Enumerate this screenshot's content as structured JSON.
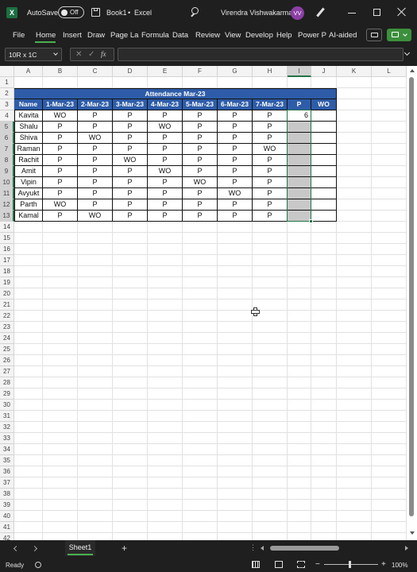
{
  "titlebar": {
    "autosave_label": "AutoSave",
    "toggle_label": "Off",
    "file_name": "Book1",
    "separator": "•",
    "app_name": "Excel",
    "user_name": "Virendra Vishwakarma",
    "avatar_initials": "VV"
  },
  "ribbon": {
    "tabs": [
      "File",
      "Home",
      "Insert",
      "Draw",
      "Page La",
      "Formula",
      "Data",
      "Review",
      "View",
      "Develop",
      "Help",
      "Power P",
      "AI-aided"
    ],
    "active_tab": "Home"
  },
  "formula_bar": {
    "name_box": "10R x 1C",
    "fx": "fx",
    "formula": ""
  },
  "grid": {
    "columns": [
      "A",
      "B",
      "C",
      "D",
      "E",
      "F",
      "G",
      "H",
      "I",
      "J",
      "K",
      "L"
    ],
    "rows": [
      "1",
      "2",
      "3",
      "4",
      "5",
      "6",
      "7",
      "8",
      "9",
      "10",
      "11",
      "12",
      "13",
      "14",
      "15",
      "16",
      "17",
      "18",
      "19",
      "20",
      "21",
      "22",
      "23",
      "24",
      "25",
      "26",
      "27",
      "28",
      "29",
      "30",
      "31",
      "32",
      "33",
      "34",
      "35",
      "36",
      "37",
      "38",
      "39",
      "40",
      "41",
      "42"
    ]
  },
  "table": {
    "title": "Attendance Mar-23",
    "headers": [
      "Name",
      "1-Mar-23",
      "2-Mar-23",
      "3-Mar-23",
      "4-Mar-23",
      "5-Mar-23",
      "6-Mar-23",
      "7-Mar-23",
      "P",
      "WO"
    ],
    "rows": [
      [
        "Kavita",
        "WO",
        "P",
        "P",
        "P",
        "P",
        "P",
        "P",
        "6",
        ""
      ],
      [
        "Shalu",
        "P",
        "P",
        "P",
        "WO",
        "P",
        "P",
        "P",
        "",
        ""
      ],
      [
        "Shiva",
        "P",
        "WO",
        "P",
        "P",
        "P",
        "P",
        "P",
        "",
        ""
      ],
      [
        "Raman",
        "P",
        "P",
        "P",
        "P",
        "P",
        "P",
        "WO",
        "",
        ""
      ],
      [
        "Rachit",
        "P",
        "P",
        "WO",
        "P",
        "P",
        "P",
        "P",
        "",
        ""
      ],
      [
        "Amit",
        "P",
        "P",
        "P",
        "WO",
        "P",
        "P",
        "P",
        "",
        ""
      ],
      [
        "Vipin",
        "P",
        "P",
        "P",
        "P",
        "WO",
        "P",
        "P",
        "",
        ""
      ],
      [
        "Avyukt",
        "P",
        "P",
        "P",
        "P",
        "P",
        "WO",
        "P",
        "",
        ""
      ],
      [
        "Parth",
        "WO",
        "P",
        "P",
        "P",
        "P",
        "P",
        "P",
        "",
        ""
      ],
      [
        "Kamal",
        "P",
        "WO",
        "P",
        "P",
        "P",
        "P",
        "P",
        "",
        ""
      ]
    ]
  },
  "sheet_tabs": {
    "active": "Sheet1",
    "add": "+"
  },
  "status": {
    "ready": "Ready",
    "zoom": "100%"
  },
  "colors": {
    "header_fill": "#2e5ca8",
    "selection": "#217346",
    "selected_fill": "#c8c8c8"
  }
}
